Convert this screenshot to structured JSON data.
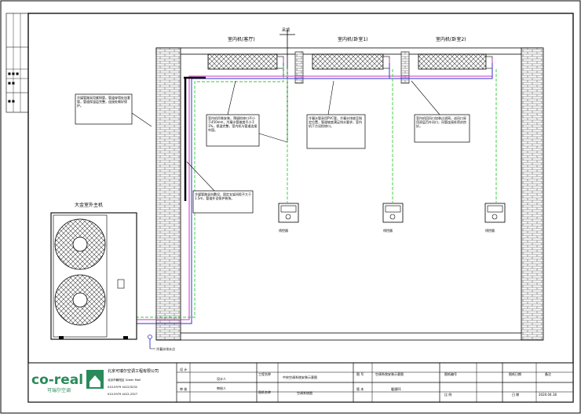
{
  "title_block": {
    "company_name": "北京可瑞尔空调工程有限公司",
    "company_address": "北京市朝阳区 Green Mall",
    "company_phone": "010-5979 4412/3232",
    "company_fax": "010-5979 4412-2327",
    "logo_text": "co-real",
    "logo_subtext": "可瑞尔空调",
    "cells": {
      "c1": "设 计",
      "c2": "审 核",
      "c3": "设计人",
      "c4": "审核人",
      "c5": "工程名称",
      "c6": "中央空调系统安装示意图",
      "c7": "图纸名称",
      "c8": "空调系统图",
      "c9": "图 号",
      "c10": "空调系统安装示意图",
      "c11": "版 本",
      "c12": "暖通01",
      "c13": "图纸编号",
      "c14": "比 例",
      "c15": "图纸日期",
      "c16": "日 期",
      "c17": "2020.04.18",
      "c18": "备注"
    }
  },
  "indoor_units": [
    "室内机(客厅)",
    "室内机(卧室1)",
    "室内机(卧室2)"
  ],
  "outdoor_unit_label": "大金室外主机",
  "top_marker_label": "吊顶",
  "controllers": [
    "线控器",
    "线控器",
    "线控器"
  ],
  "callouts": {
    "outdoor_pipe": "冷媒管路采用紫铜管，管道穿墙处加套管，管道保温层完整，连接处做好保护。",
    "indoor_left": "室内机吊装安装，预留检修口不小于450mm，冷凝水管坡度不小于1%，保温完整，室内机与管道连接牢固。",
    "indoor_mid": "冷凝水管采用PVC管，冷凝水排放至指定位置，管道坡度满足排水要求，室内机下方设检修口。",
    "indoor_right": "室内机回风口加装过滤网，送风口采用双层百叶风口，风管连接处密封良好。",
    "riser": "冷媒管路竖向敷设，固定支架间距不大于1.5m，管道外设保护装饰。",
    "drain_note": "冷凝水排水点"
  },
  "colors": {
    "wall_fill": "#fdfdfd",
    "line": "#000000",
    "refrigerant_pipe": "#cc33cc",
    "liquid_pipe": "#3333cc",
    "control_wire": "#33cc33",
    "logo_green": "#2a8a5a"
  }
}
